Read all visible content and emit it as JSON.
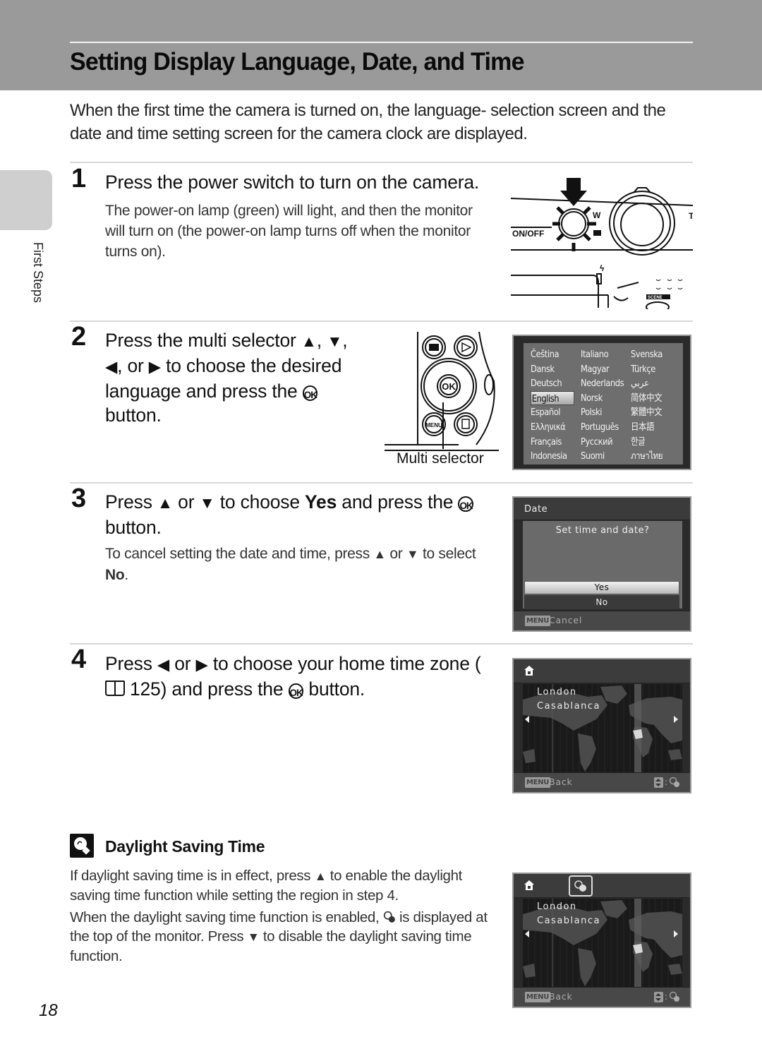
{
  "page": {
    "title": "Setting Display Language, Date, and Time",
    "intro": "When the first time the camera is turned on, the language- selection screen and the date and time setting screen for the camera clock are displayed.",
    "side_tab_label": "First Steps",
    "page_number": "18"
  },
  "icons": {
    "up": "▲",
    "down": "▼",
    "left": "◀",
    "right": "▶",
    "ok": "OK"
  },
  "steps": [
    {
      "number": "1",
      "heading": "Press the power switch to turn on the camera.",
      "body": "The power-on lamp (green) will light, and then the monitor will turn on (the power-on lamp turns off when the monitor turns on).",
      "illustration_labels": {
        "power": "ON/OFF",
        "zoom_w": "W",
        "scene": "SCENE"
      }
    },
    {
      "number": "2",
      "heading_parts": [
        "Press the multi selector ",
        ", ",
        ",",
        ", or ",
        " to choose the desired language and press the ",
        " button."
      ],
      "caption": "Multi selector",
      "illustration_labels": {
        "menu": "MENU",
        "ok": "OK"
      }
    },
    {
      "number": "3",
      "heading_parts": [
        "Press ",
        " or ",
        " to choose ",
        "Yes",
        " and press the ",
        " button."
      ],
      "body_parts": [
        "To cancel setting the date and time, press ",
        " or ",
        " to select ",
        "No",
        "."
      ]
    },
    {
      "number": "4",
      "heading_parts": [
        "Press ",
        " or ",
        " to choose your home time zone (",
        " 125) and press the ",
        " button."
      ]
    }
  ],
  "language_screen": {
    "selected": "English",
    "languages": [
      "Čeština",
      "Italiano",
      "Svenska",
      "Dansk",
      "Magyar",
      "Türkçe",
      "Deutsch",
      "Nederlands",
      "عربي",
      "English",
      "Norsk",
      "简体中文",
      "Español",
      "Polski",
      "繁體中文",
      "Ελληνικά",
      "Português",
      "日本語",
      "Français",
      "Русский",
      "한글",
      "Indonesia",
      "Suomi",
      "ภาษาไทย"
    ]
  },
  "date_screen": {
    "title": "Date",
    "question": "Set time and date?",
    "options": [
      "Yes",
      "No"
    ],
    "selected": "Yes",
    "menu_key": "MENU",
    "footer": "Cancel"
  },
  "map_screen": {
    "cities": [
      "London",
      "Casablanca"
    ],
    "menu_key": "MENU",
    "footer": "Back",
    "footer_right_sep": ":"
  },
  "map_screen_dst": {
    "cities": [
      "London",
      "Casablanca"
    ],
    "menu_key": "MENU",
    "footer": "Back",
    "footer_right_sep": ":"
  },
  "tip": {
    "title": "Daylight Saving Time",
    "para1_parts": [
      "If daylight saving time is in effect, press ",
      " to enable the daylight saving time function while setting the region in step 4."
    ],
    "para2_parts": [
      "When the daylight saving time function is enabled, ",
      " is displayed at the top of the monitor. Press ",
      " to disable the daylight saving time function."
    ]
  }
}
